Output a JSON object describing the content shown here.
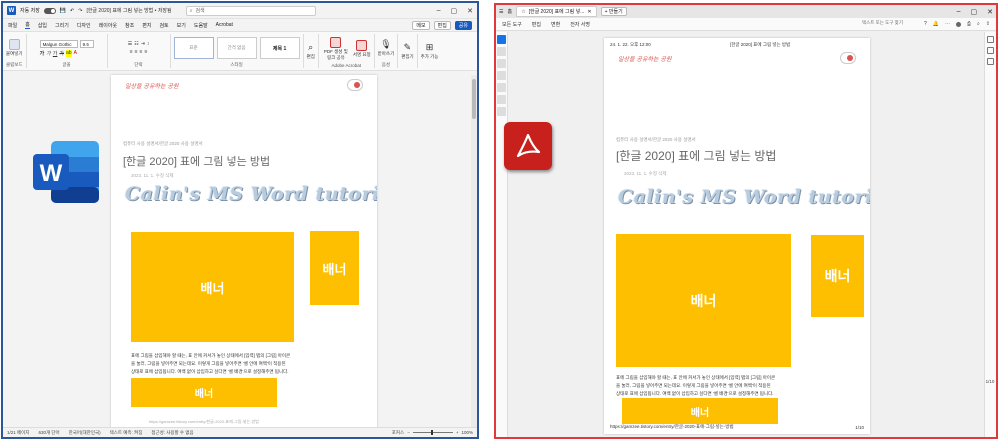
{
  "word": {
    "titlebar": {
      "autosave_label": "자동 저장",
      "doc_title": "[한글 2020] 표에 그림 넣는 방법 • 저장됨",
      "search_placeholder": "검색"
    },
    "menu": [
      "파일",
      "홈",
      "삽입",
      "그리기",
      "디자인",
      "레이아웃",
      "참조",
      "편지",
      "검토",
      "보기",
      "도움말",
      "Acrobat"
    ],
    "menu_right": {
      "comment": "메모",
      "edit": "편집",
      "share": "공유"
    },
    "ribbon": {
      "paste_label": "붙여넣기",
      "clipboard_label": "클립보드",
      "font_name": "Malgun Gothic",
      "font_size": "9.5",
      "font_group_label": "글꼴",
      "paragraph_label": "단락",
      "style_items": [
        "표준",
        "간격 없음",
        "제목 1"
      ],
      "style_group_label": "스타일",
      "editing_label": "편집",
      "pdf_create_label": "PDF 생성 및 링크 공유",
      "sign_label": "서명 요청",
      "acrobat_label": "Adobe Acrobat",
      "voice_label": "받아쓰기",
      "voice_group_label": "음성",
      "editor_label": "편집기",
      "addins_label": "추가 기능"
    },
    "page": {
      "blog_logo": "일상을 공유하는 공원",
      "breadcrumb": "컴퓨터 사용 설명서/한글 2020 사용 설명서",
      "title": "[한글 2020] 표에 그림 넣는 방법",
      "meta": "2023. 11. 1.   수정   삭제",
      "tutorial_banner": "Calin's MS Word tutorials",
      "banner_label": "배너",
      "body_lines": [
        "표에 그림을 삽입해야 할 때는, 표 안에 커서가 놓인 상태에서 [입력] 탭의 [그림] 아이콘",
        "을 눌러, 그림을 넣어주면 되는데요. 이렇게 그림을 넣어주면 '셀 안에 여백'이 적용된",
        "상태로 표에 삽입됩니다. 여백 없이 삽입하고 싶다면 '셀 배경'으로 설정해주면 됩니다."
      ],
      "footer_url": "https://gamzee.tistory.com/entry/한글-2020-표에-그림-넣는-방법"
    },
    "status": {
      "page": "1/21 페이지",
      "words": "630개 단어",
      "lang": "한국어(대한민국)",
      "text_pred": "텍스트 예측: 켜짐",
      "accessibility": "접근성: 사용할 수 없음",
      "focus": "포커스",
      "zoom": "100%"
    }
  },
  "acrobat": {
    "tabs": {
      "home": "홈",
      "doc": "[한글 2020] 표에 그림 넣...",
      "new_tab": "+ 만들기"
    },
    "toolbar": [
      "모든 도구",
      "편집",
      "변환",
      "전자 서명"
    ],
    "search": "텍스트 또는 도구 찾기",
    "page": {
      "header_date": "24. 1. 22. 오후 12:00",
      "header_title": "[한글 2020] 표에 그림 넣는 방법",
      "footer_url": "https://gamzee.tistory.com/entry/한글-2020-표에-그림-넣는-방법",
      "page_num": "1/10"
    },
    "page_count_side": "1\n10"
  },
  "colors": {
    "word_blue": "#2b579a",
    "acrobat_red": "#e0393b",
    "banner_yellow": "#fdbf00"
  }
}
